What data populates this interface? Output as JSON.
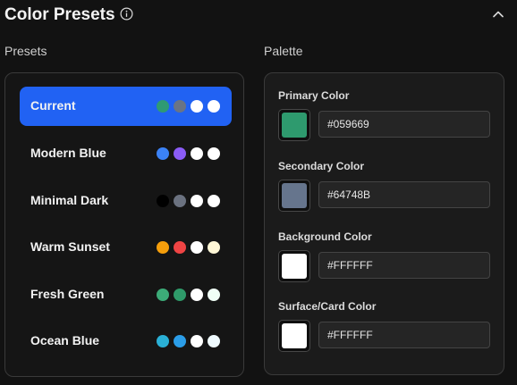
{
  "header": {
    "title": "Color Presets",
    "info_icon": "info-circle-icon",
    "collapse_icon": "chevron-up-icon"
  },
  "sections": {
    "presets_label": "Presets",
    "palette_label": "Palette"
  },
  "presets": [
    {
      "name": "Current",
      "active": true,
      "colors": [
        "#2f9a74",
        "#6a7485",
        "#ffffff",
        "#ffffff"
      ]
    },
    {
      "name": "Modern Blue",
      "active": false,
      "colors": [
        "#3b82f6",
        "#8b5cf6",
        "#ffffff",
        "#ffffff"
      ]
    },
    {
      "name": "Minimal Dark",
      "active": false,
      "colors": [
        "#000000",
        "#6b7280",
        "#ffffff",
        "#ffffff"
      ]
    },
    {
      "name": "Warm Sunset",
      "active": false,
      "colors": [
        "#f59e0b",
        "#ef4444",
        "#ffffff",
        "#fff7d6"
      ]
    },
    {
      "name": "Fresh Green",
      "active": false,
      "colors": [
        "#3cab78",
        "#2f9a6a",
        "#ffffff",
        "#f0fff6"
      ]
    },
    {
      "name": "Ocean Blue",
      "active": false,
      "colors": [
        "#2ab0d6",
        "#2b9de8",
        "#ffffff",
        "#f0fbff"
      ]
    }
  ],
  "palette": [
    {
      "label": "Primary Color",
      "value": "#059669",
      "swatch": "#2e9a6e"
    },
    {
      "label": "Secondary Color",
      "value": "#64748B",
      "swatch": "#66758d"
    },
    {
      "label": "Background Color",
      "value": "#FFFFFF",
      "swatch": "#ffffff"
    },
    {
      "label": "Surface/Card Color",
      "value": "#FFFFFF",
      "swatch": "#ffffff"
    }
  ],
  "colors": {
    "accent": "#2162f3",
    "page_bg": "#121212"
  }
}
